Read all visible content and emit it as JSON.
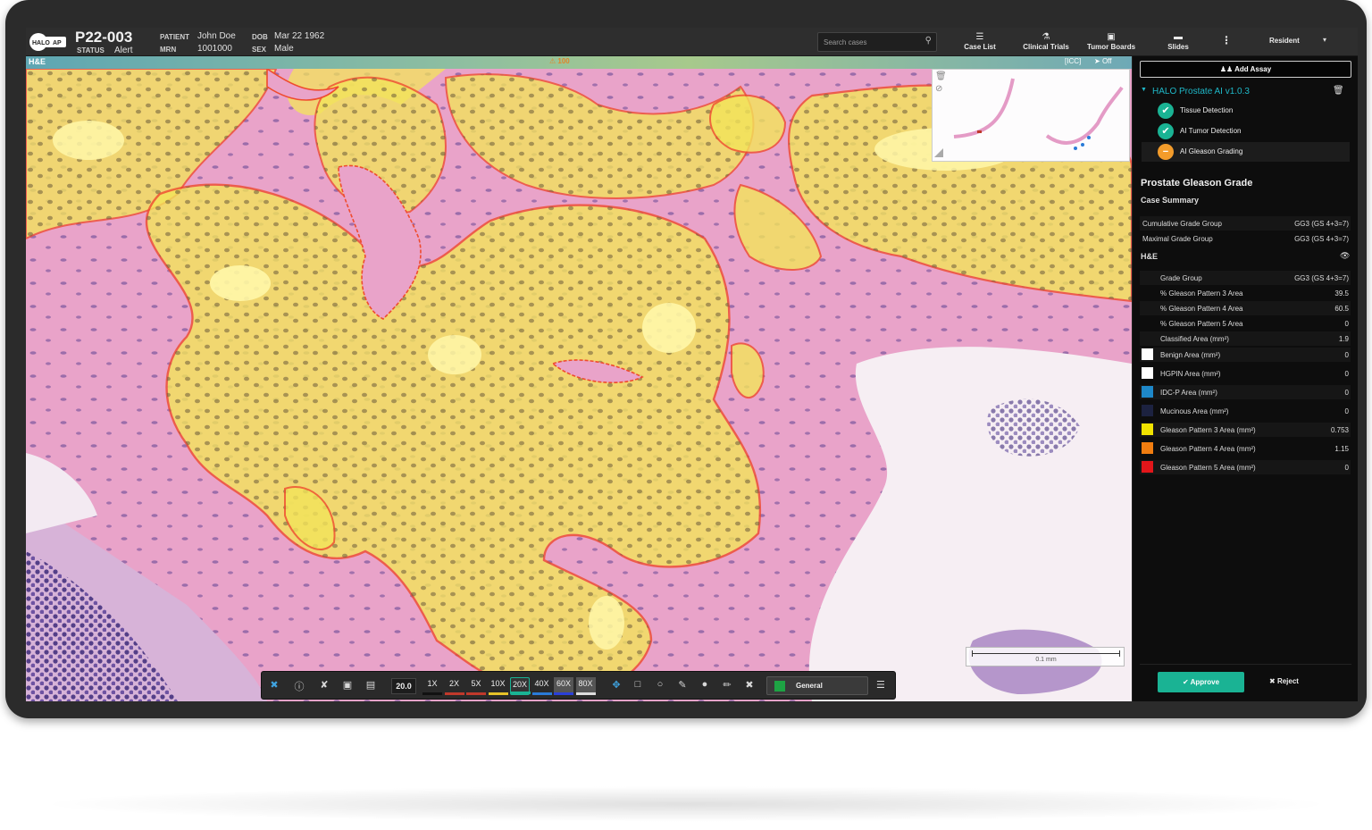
{
  "header": {
    "case_id": "P22-003",
    "status_label": "STATUS",
    "status_value": "Alert",
    "patient_label": "PATIENT",
    "patient_value": "John Doe",
    "mrn_label": "MRN",
    "mrn_value": "1001000",
    "dob_label": "DOB",
    "dob_value": "Mar 22 1962",
    "sex_label": "SEX",
    "sex_value": "Male",
    "search_placeholder": "Search cases",
    "nav": [
      "Case List",
      "Clinical Trials",
      "Tumor Boards",
      "Slides"
    ],
    "user": "Resident",
    "logo_text": "HALO AP"
  },
  "viewer": {
    "stain": "H&E",
    "warning": "⚠ 100",
    "icc": "[ICC]",
    "off": "Off",
    "scale_label": "0.1 mm"
  },
  "toolbar": {
    "zoom_value": "20.0",
    "magnifications": [
      {
        "label": "1X",
        "color": "#111111"
      },
      {
        "label": "2X",
        "color": "#c0392b"
      },
      {
        "label": "5X",
        "color": "#c0392b"
      },
      {
        "label": "10X",
        "color": "#e6c229"
      },
      {
        "label": "20X",
        "color": "#1ab394"
      },
      {
        "label": "40X",
        "color": "#2a7bd8"
      },
      {
        "label": "60X",
        "color": "#2a3fd8"
      },
      {
        "label": "80X",
        "color": "#dddddd"
      }
    ],
    "active_magnification": "20X",
    "layer_name": "General",
    "layer_color": "#1ea344"
  },
  "panel": {
    "add_assay": "Add Assay",
    "assay_name": "HALO Prostate AI v1.0.3",
    "steps": [
      {
        "label": "Tissue Detection",
        "state": "done"
      },
      {
        "label": "AI Tumor Detection",
        "state": "done"
      },
      {
        "label": "AI Gleason Grading",
        "state": "pending"
      }
    ],
    "title": "Prostate Gleason Grade",
    "case_summary": "Case Summary",
    "summary": [
      {
        "k": "Cumulative Grade Group",
        "v": "GG3 (GS 4+3=7)"
      },
      {
        "k": "Maximal Grade Group",
        "v": "GG3 (GS 4+3=7)"
      }
    ],
    "he_label": "H&E",
    "he_rows": [
      {
        "k": "Grade Group",
        "v": "GG3 (GS 4+3=7)"
      },
      {
        "k": "% Gleason Pattern 3 Area",
        "v": "39.5"
      },
      {
        "k": "% Gleason Pattern 4 Area",
        "v": "60.5"
      },
      {
        "k": "% Gleason Pattern 5 Area",
        "v": "0"
      },
      {
        "k": "Classified Area (mm²)",
        "v": "1.9"
      }
    ],
    "class_rows": [
      {
        "k": "Benign Area (mm²)",
        "v": "0",
        "color": "#ffffff"
      },
      {
        "k": "HGPIN Area (mm²)",
        "v": "0",
        "color": "#ffffff"
      },
      {
        "k": "IDC-P Area (mm²)",
        "v": "0",
        "color": "#1e88c9"
      },
      {
        "k": "Mucinous Area (mm²)",
        "v": "0",
        "color": "#1c2240"
      },
      {
        "k": "Gleason Pattern 3 Area (mm²)",
        "v": "0.753",
        "color": "#f1e300"
      },
      {
        "k": "Gleason Pattern 4 Area (mm²)",
        "v": "1.15",
        "color": "#f07d10"
      },
      {
        "k": "Gleason Pattern 5 Area (mm²)",
        "v": "0",
        "color": "#e3161a"
      }
    ],
    "approve": "Approve",
    "reject": "Reject"
  },
  "colors": {
    "accent": "#1ab394",
    "assay": "#1fb8c8",
    "tumor_outline": "#ef4b2e",
    "gp3_fill": "#f3e45a",
    "stroma": "#e9a3c9"
  }
}
